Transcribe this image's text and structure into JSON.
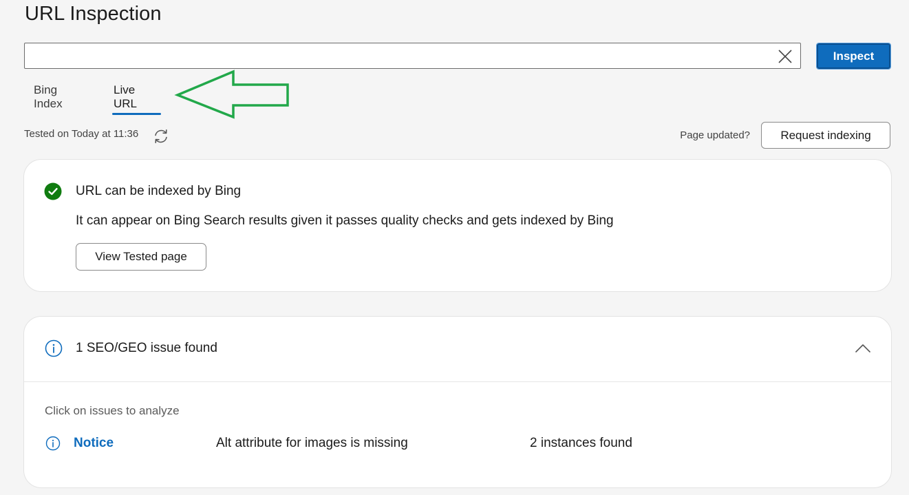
{
  "header": {
    "title": "URL Inspection"
  },
  "search": {
    "value": "",
    "placeholder": "",
    "inspect_label": "Inspect"
  },
  "tabs": [
    {
      "label": "Bing Index",
      "selected": false
    },
    {
      "label": "Live URL",
      "selected": true
    }
  ],
  "status": {
    "tested": "Tested on Today at 11:36",
    "page_updated": "Page updated?",
    "request_label": "Request indexing"
  },
  "index_card": {
    "title": "URL can be indexed by Bing",
    "description": "It can appear on Bing Search results given it passes quality checks and gets indexed by Bing",
    "view_label": "View Tested page"
  },
  "issues_card": {
    "title": "1 SEO/GEO issue found",
    "hint": "Click on issues to analyze",
    "issues": [
      {
        "severity": "Notice",
        "description": "Alt attribute for images is missing",
        "count": "2 instances found"
      }
    ]
  },
  "icons": {
    "clear": "close-icon",
    "refresh": "refresh-icon",
    "check": "check-circle-icon",
    "info": "info-icon",
    "chevron": "chevron-up-icon"
  },
  "colors": {
    "accent": "#0f6cbd",
    "success": "#107c10",
    "annotation": "#22a84a",
    "background": "#f5f5f5"
  }
}
